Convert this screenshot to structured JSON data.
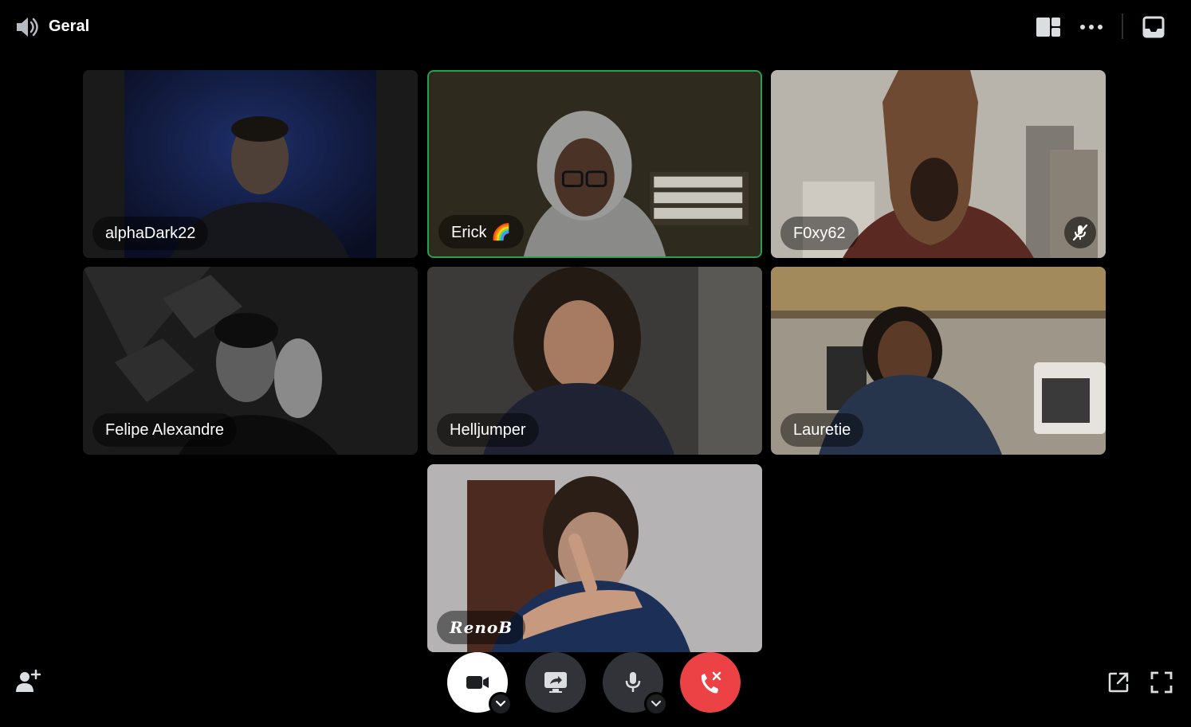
{
  "channel": {
    "name": "Geral",
    "icon": "speaker-icon"
  },
  "toolbar": {
    "layout_icon": "grid-layout-icon",
    "more_icon": "more-dots-icon",
    "inbox_icon": "inbox-icon"
  },
  "participants": [
    {
      "name": "alphaDark22",
      "speaking": false,
      "muted": false
    },
    {
      "name": "Erick 🌈",
      "speaking": true,
      "muted": false
    },
    {
      "name": "F0xy62",
      "speaking": false,
      "muted": true
    },
    {
      "name": "Felipe Alexandre",
      "speaking": false,
      "muted": false
    },
    {
      "name": "Helljumper",
      "speaking": false,
      "muted": false
    },
    {
      "name": "Lauretie",
      "speaking": false,
      "muted": false
    },
    {
      "name": "RenoB",
      "speaking": false,
      "muted": false
    }
  ],
  "controls": {
    "camera_icon": "camera-icon",
    "share_icon": "screen-share-icon",
    "mic_icon": "microphone-icon",
    "hangup_icon": "hang-up-icon"
  },
  "colors": {
    "speaking_ring": "#2e9e4f",
    "hangup": "#ed4245",
    "control_bg": "#313338"
  }
}
